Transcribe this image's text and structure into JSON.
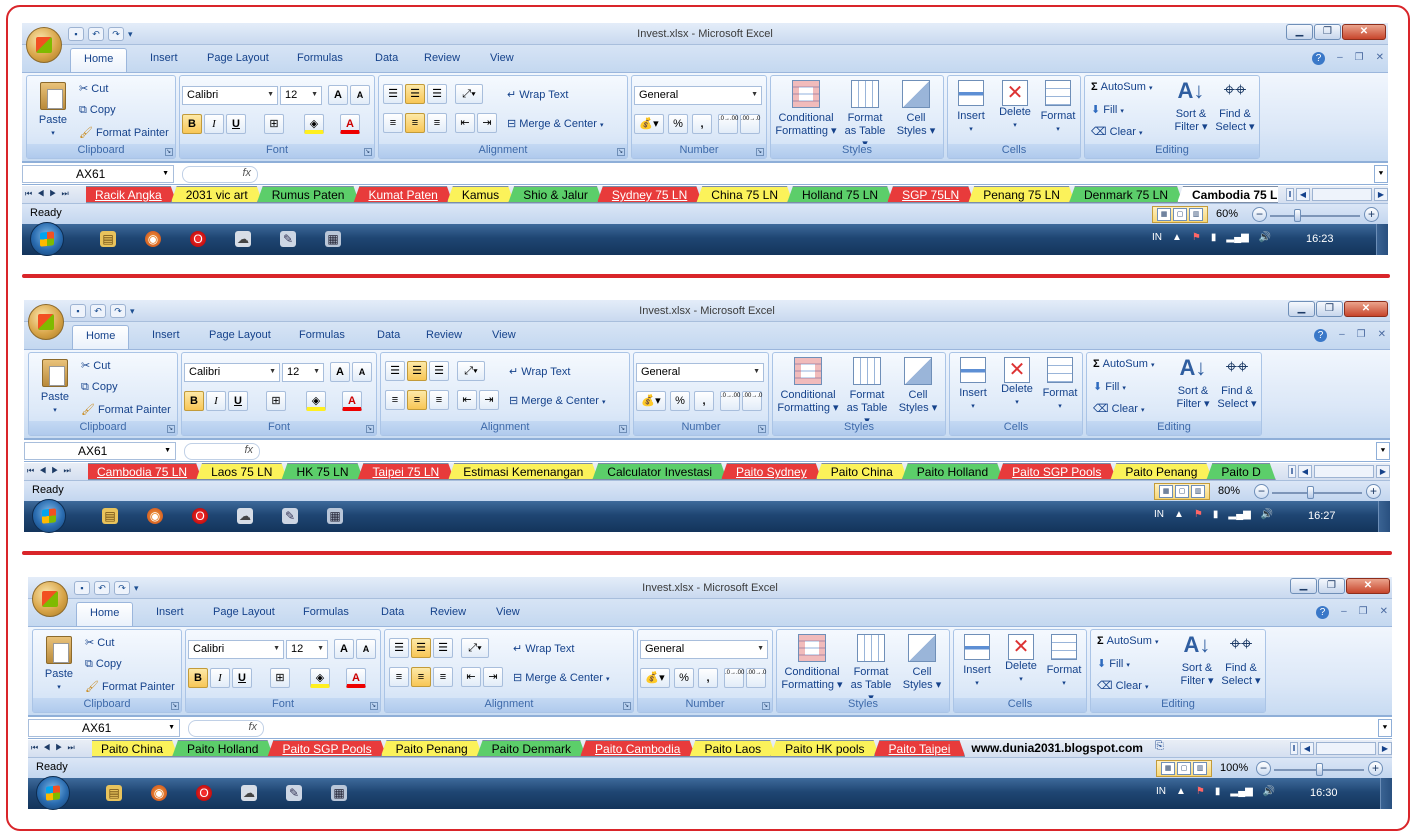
{
  "colors": {
    "frame": "#d9252a",
    "tab_red": "#e83b3b",
    "tab_yellow": "#fbf25a",
    "tab_green": "#5cce6a",
    "ribbon": "#dbe7f7",
    "taskbar": "#1f4673"
  },
  "window": {
    "title": "Invest.xlsx - Microsoft Excel"
  },
  "ribbon_tabs": [
    "Home",
    "Insert",
    "Page Layout",
    "Formulas",
    "Data",
    "Review",
    "View"
  ],
  "clipboard": {
    "paste": "Paste",
    "cut": "Cut",
    "copy": "Copy",
    "format_painter": "Format Painter",
    "group": "Clipboard"
  },
  "font": {
    "name": "Calibri",
    "size": "12",
    "bold": "B",
    "italic": "I",
    "underline": "U",
    "grow": "A",
    "shrink": "A",
    "color_a": "A",
    "group": "Font"
  },
  "alignment": {
    "wrap": "Wrap Text",
    "merge": "Merge & Center",
    "group": "Alignment"
  },
  "number": {
    "format": "General",
    "percent": "%",
    "comma": ",",
    "inc": ".0→.00",
    "dec": ".00→.0",
    "group": "Number"
  },
  "styles": {
    "conditional_1": "Conditional",
    "conditional_2": "Formatting",
    "format_table_1": "Format",
    "format_table_2": "as Table",
    "cell_styles_1": "Cell",
    "cell_styles_2": "Styles",
    "group": "Styles"
  },
  "cells": {
    "insert": "Insert",
    "delete": "Delete",
    "format": "Format",
    "group": "Cells"
  },
  "editing": {
    "autosum": "AutoSum",
    "fill": "Fill",
    "clear": "Clear",
    "sort_1": "Sort &",
    "sort_2": "Filter",
    "find_1": "Find &",
    "find_2": "Select",
    "group": "Editing"
  },
  "formula_bar": {
    "name_box": "AX61",
    "fx": "fx"
  },
  "status": {
    "ready": "Ready"
  },
  "tray": {
    "lang": "IN"
  },
  "panels": [
    {
      "zoom": "60%",
      "zoom_fraction": 0.3,
      "clock": "16:23",
      "sheets": [
        {
          "label": "Racik Angka",
          "color": "red"
        },
        {
          "label": "2031 vic art",
          "color": "yellow"
        },
        {
          "label": "Rumus Paten",
          "color": "green"
        },
        {
          "label": "Kumat Paten",
          "color": "red"
        },
        {
          "label": "Kamus",
          "color": "yellow"
        },
        {
          "label": "Shio & Jalur",
          "color": "green"
        },
        {
          "label": "Sydney 75 LN",
          "color": "red"
        },
        {
          "label": "China 75 LN",
          "color": "yellow"
        },
        {
          "label": "Holland 75 LN",
          "color": "green"
        },
        {
          "label": "SGP 75LN",
          "color": "red"
        },
        {
          "label": "Penang 75 LN",
          "color": "yellow"
        },
        {
          "label": "Denmark 75 LN",
          "color": "green"
        },
        {
          "label": "Cambodia 75 L",
          "color": "active"
        }
      ],
      "blog": ""
    },
    {
      "zoom": "80%",
      "zoom_fraction": 0.42,
      "clock": "16:27",
      "sheets": [
        {
          "label": "Cambodia 75 LN",
          "color": "red"
        },
        {
          "label": "Laos 75 LN",
          "color": "yellow"
        },
        {
          "label": "HK 75 LN",
          "color": "green"
        },
        {
          "label": "Taipei 75 LN",
          "color": "red"
        },
        {
          "label": "Estimasi Kemenangan",
          "color": "yellow"
        },
        {
          "label": "Calculator Investasi",
          "color": "green"
        },
        {
          "label": "Paito Sydney",
          "color": "red"
        },
        {
          "label": "Paito China",
          "color": "yellow"
        },
        {
          "label": "Paito Holland",
          "color": "green"
        },
        {
          "label": "Paito SGP Pools",
          "color": "red"
        },
        {
          "label": "Paito Penang",
          "color": "yellow"
        },
        {
          "label": "Paito D",
          "color": "green"
        }
      ],
      "blog": ""
    },
    {
      "zoom": "100%",
      "zoom_fraction": 0.5,
      "clock": "16:30",
      "sheets": [
        {
          "label": "Paito China",
          "color": "yellow"
        },
        {
          "label": "Paito Holland",
          "color": "green"
        },
        {
          "label": "Paito SGP Pools",
          "color": "red"
        },
        {
          "label": "Paito Penang",
          "color": "yellow"
        },
        {
          "label": "Paito Denmark",
          "color": "green"
        },
        {
          "label": "Paito Cambodia",
          "color": "red"
        },
        {
          "label": "Paito Laos",
          "color": "yellow"
        },
        {
          "label": "Paito HK pools",
          "color": "yellow"
        },
        {
          "label": "Paito Taipei",
          "color": "red"
        }
      ],
      "blog": "www.dunia2031.blogspot.com"
    }
  ]
}
